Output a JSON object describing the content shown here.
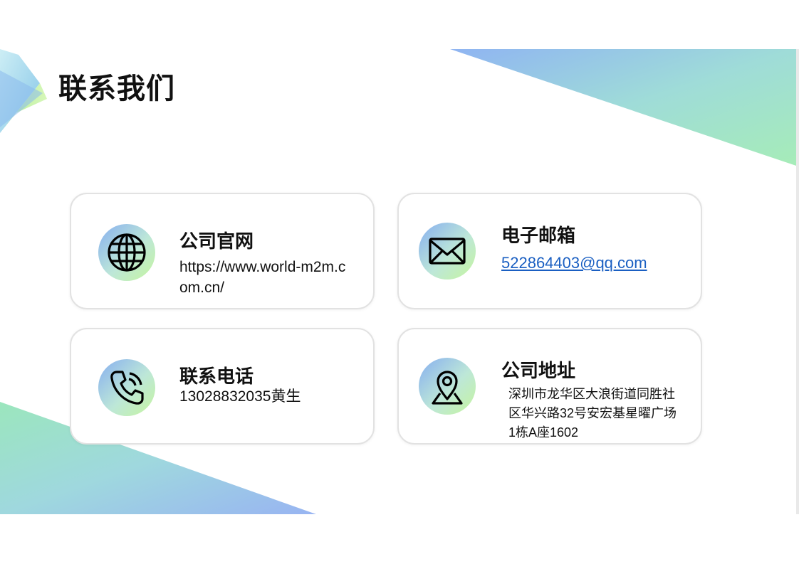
{
  "page": {
    "title": "联系我们"
  },
  "contacts": [
    {
      "id": "website",
      "title": "公司官网",
      "value": "https://www.world-m2m.com.cn/",
      "icon": "globe-icon"
    },
    {
      "id": "email",
      "title": "电子邮箱",
      "value": "522864403@qq.com",
      "icon": "envelope-icon"
    },
    {
      "id": "phone",
      "title": "联系电话",
      "value": "13028832035黄生",
      "icon": "phone-icon"
    },
    {
      "id": "address",
      "title": "公司地址",
      "value": "深圳市龙华区大浪街道同胜社区华兴路32号安宏基星曜广场1栋A座1602",
      "icon": "map-pin-icon"
    }
  ],
  "colors": {
    "gradient_blue": "#86aef0",
    "gradient_green": "#c6f59e",
    "link": "#1a5fc2",
    "text": "#111111"
  }
}
